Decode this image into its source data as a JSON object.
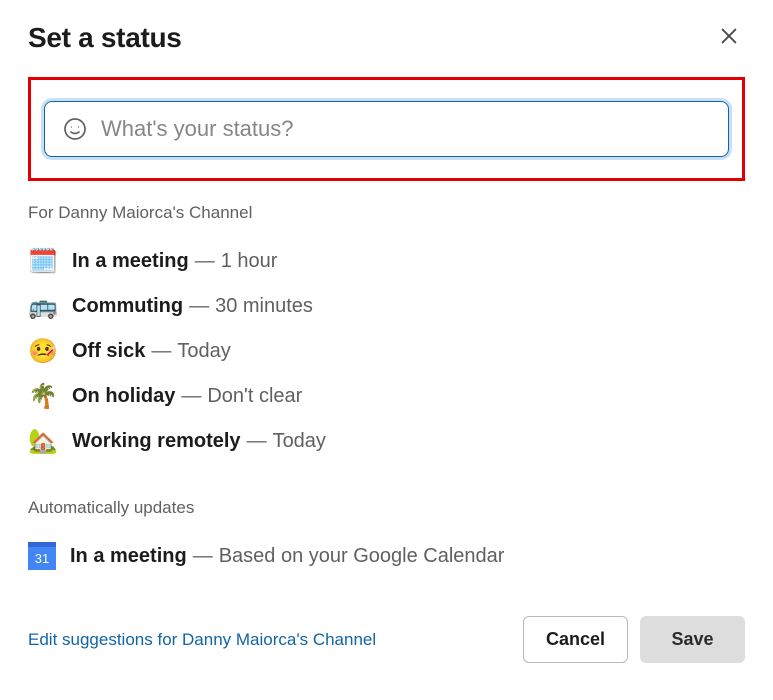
{
  "header": {
    "title": "Set a status"
  },
  "input": {
    "placeholder": "What's your status?",
    "value": ""
  },
  "suggestions_header": "For Danny Maiorca's Channel",
  "suggestions": [
    {
      "emoji": "🗓️",
      "label": "In a meeting",
      "duration": "1 hour"
    },
    {
      "emoji": "🚌",
      "label": "Commuting",
      "duration": "30 minutes"
    },
    {
      "emoji": "🤒",
      "label": "Off sick",
      "duration": "Today"
    },
    {
      "emoji": "🌴",
      "label": "On holiday",
      "duration": "Don't clear"
    },
    {
      "emoji": "🏡",
      "label": "Working remotely",
      "duration": "Today"
    }
  ],
  "auto_header": "Automatically updates",
  "auto_item": {
    "icon_text": "31",
    "label": "In a meeting",
    "duration": "Based on your Google Calendar"
  },
  "footer": {
    "edit_link": "Edit suggestions for Danny Maiorca's Channel",
    "cancel": "Cancel",
    "save": "Save"
  },
  "dash": "—"
}
